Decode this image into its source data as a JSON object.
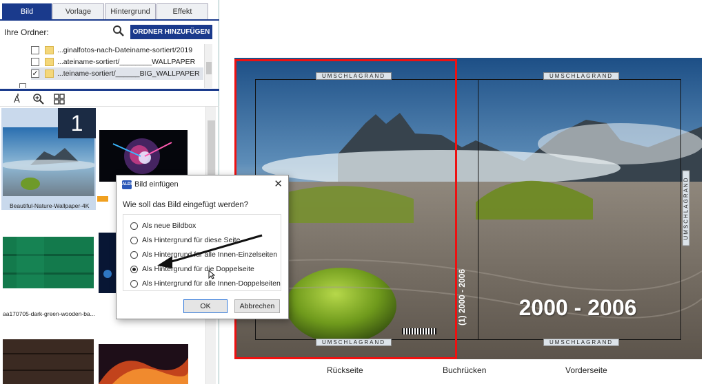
{
  "tabs": [
    {
      "label": "Bild",
      "active": true
    },
    {
      "label": "Vorlage"
    },
    {
      "label": "Hintergrund"
    },
    {
      "label": "Effekt"
    }
  ],
  "folders": {
    "label": "Ihre Ordner:",
    "add_button": "ORDNER HINZUFÜGEN",
    "rows": [
      {
        "name": "...ginalfotos-nach-Dateiname-sortiert/2019",
        "checked": false
      },
      {
        "name": "...ateiname-sortiert/________WALLPAPER",
        "checked": false
      },
      {
        "name": "...teiname-sortiert/______BIG_WALLPAPER",
        "checked": true
      }
    ]
  },
  "thumbnails": [
    {
      "caption": "Beautiful-Nature-Wallpaper-4K",
      "badge": "1"
    },
    {
      "caption": ""
    },
    {
      "caption": "aa170705-dark-green-wooden-ba..."
    },
    {
      "caption": ""
    }
  ],
  "dialog": {
    "title": "Bild einfügen",
    "icon_text": "ALDI",
    "question": "Wie soll das Bild eingefügt werden?",
    "options": [
      {
        "label": "Als neue Bildbox",
        "selected": false
      },
      {
        "label": "Als Hintergrund für diese Seite",
        "selected": false
      },
      {
        "label": "Als Hintergrund für alle Innen-Einzelseiten",
        "selected": false
      },
      {
        "label": "Als Hintergrund für die Doppelseite",
        "selected": true
      },
      {
        "label": "Als Hintergrund für alle Innen-Doppelseiten",
        "selected": false
      }
    ],
    "ok": "OK",
    "cancel": "Abbrechen"
  },
  "cover": {
    "margin_label": "UMSCHLAGRAND",
    "title": "2000 - 2006",
    "spine_text": "(1)  2000 - 2006",
    "back_label": "Rückseite",
    "spine_label": "Buchrücken",
    "front_label": "Vorderseite"
  },
  "colors": {
    "accent": "#1a3a8c",
    "selection_frame": "#e11111"
  }
}
